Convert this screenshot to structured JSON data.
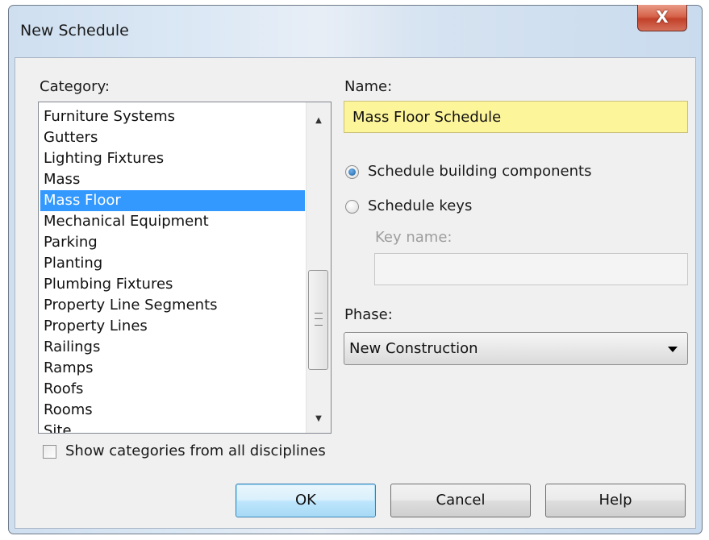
{
  "window": {
    "title": "New Schedule",
    "close_symbol": "X"
  },
  "category": {
    "label": "Category:",
    "items": [
      "Furniture Systems",
      "Gutters",
      "Lighting Fixtures",
      "Mass",
      "Mass Floor",
      "Mechanical Equipment",
      "Parking",
      "Planting",
      "Plumbing Fixtures",
      "Property Line Segments",
      "Property Lines",
      "Railings",
      "Ramps",
      "Roofs",
      "Rooms",
      "Site"
    ],
    "selected": "Mass Floor"
  },
  "name": {
    "label": "Name:",
    "value": "Mass Floor Schedule"
  },
  "schedule_type": {
    "options": [
      "Schedule building components",
      "Schedule keys"
    ],
    "selected": "Schedule building components"
  },
  "key_name": {
    "label": "Key name:",
    "value": ""
  },
  "phase": {
    "label": "Phase:",
    "value": "New Construction"
  },
  "show_all_disciplines": {
    "label": "Show categories from all disciplines",
    "checked": false
  },
  "buttons": {
    "ok": "OK",
    "cancel": "Cancel",
    "help": "Help"
  }
}
